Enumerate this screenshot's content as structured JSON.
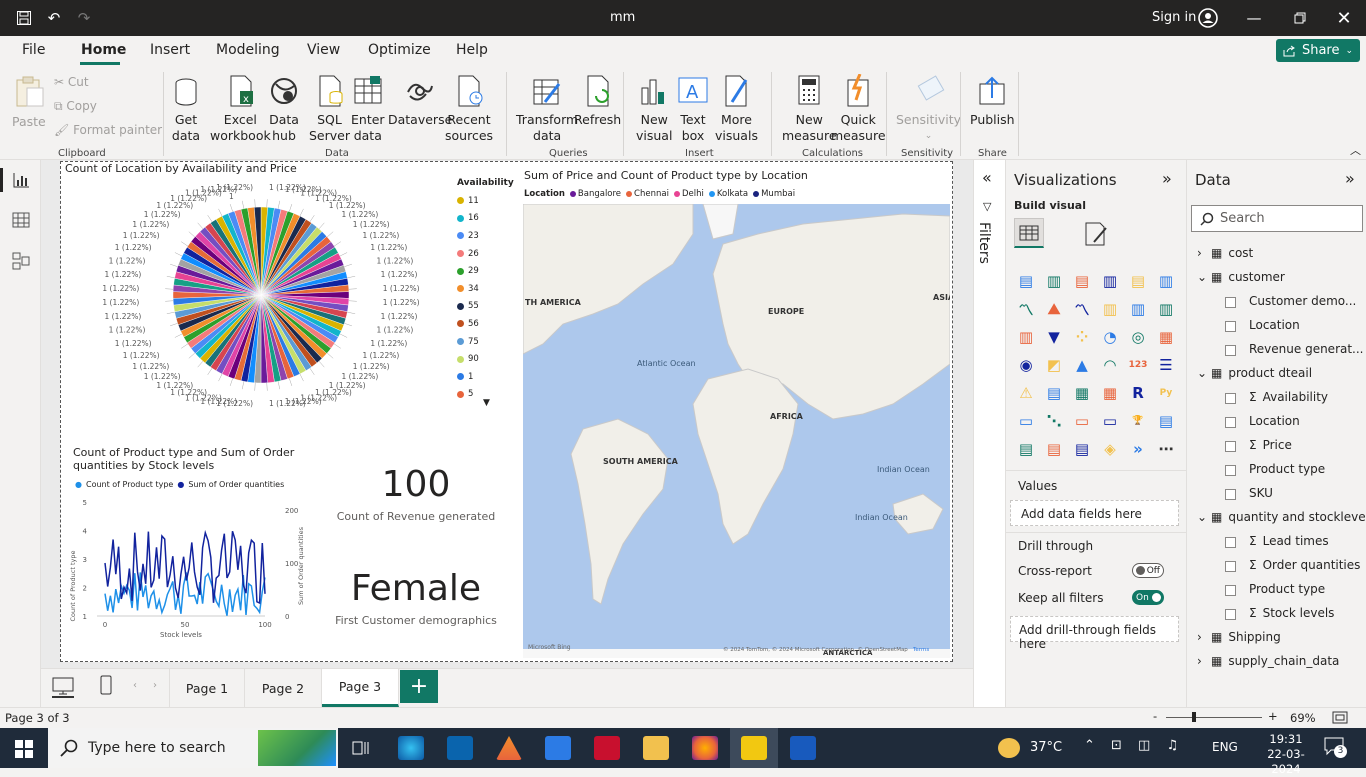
{
  "titlebar": {
    "title": "mm",
    "signin": "Sign in"
  },
  "menu": [
    "File",
    "Home",
    "Insert",
    "Modeling",
    "View",
    "Optimize",
    "Help"
  ],
  "share": "Share",
  "ribbon": {
    "clipboard": {
      "paste": "Paste",
      "cut": "Cut",
      "copy": "Copy",
      "format": "Format painter",
      "group": "Clipboard"
    },
    "data": {
      "get": [
        "Get",
        "data"
      ],
      "excel": [
        "Excel",
        "workbook"
      ],
      "hub": [
        "Data",
        "hub"
      ],
      "sql": [
        "SQL",
        "Server"
      ],
      "enter": [
        "Enter",
        "data"
      ],
      "dataverse": "Dataverse",
      "recent": [
        "Recent",
        "sources"
      ],
      "group": "Data"
    },
    "queries": {
      "transform": [
        "Transform",
        "data"
      ],
      "refresh": "Refresh",
      "group": "Queries"
    },
    "insert": {
      "new": [
        "New",
        "visual"
      ],
      "text": [
        "Text",
        "box"
      ],
      "more": [
        "More",
        "visuals"
      ],
      "group": "Insert"
    },
    "calc": {
      "measure": [
        "New",
        "measure"
      ],
      "quick": [
        "Quick",
        "measure"
      ],
      "group": "Calculations"
    },
    "sens": {
      "label": "Sensitivity",
      "group": "Sensitivity"
    },
    "share": {
      "publish": "Publish",
      "group": "Share"
    }
  },
  "pie": {
    "title": "Count of Location by Availability and Price",
    "slice_label": "1 (1.22%)",
    "top_label": "1",
    "legend_title": "Availability",
    "legend": [
      {
        "v": "11",
        "c": "#d9b300"
      },
      {
        "v": "16",
        "c": "#12b5cb"
      },
      {
        "v": "23",
        "c": "#4b8bf5"
      },
      {
        "v": "26",
        "c": "#f47b7b"
      },
      {
        "v": "29",
        "c": "#2ca02c"
      },
      {
        "v": "34",
        "c": "#f28e2b"
      },
      {
        "v": "55",
        "c": "#1b2a4e"
      },
      {
        "v": "56",
        "c": "#c0501f"
      },
      {
        "v": "75",
        "c": "#5b9bd5"
      },
      {
        "v": "90",
        "c": "#c6de6b"
      },
      {
        "v": "1",
        "c": "#2c7be5"
      },
      {
        "v": "5",
        "c": "#e8643c"
      }
    ]
  },
  "map": {
    "title": "Sum of Price and Count of Product type by Location",
    "legend_title": "Location",
    "legend": [
      {
        "n": "Bangalore",
        "c": "#6a1b9a"
      },
      {
        "n": "Chennai",
        "c": "#e8643c"
      },
      {
        "n": "Delhi",
        "c": "#e84393"
      },
      {
        "n": "Kolkata",
        "c": "#2196f3"
      },
      {
        "n": "Mumbai",
        "c": "#1a237e"
      }
    ],
    "labels": {
      "na": "TH AMERICA",
      "eu": "EUROPE",
      "asia": "ASIA",
      "atl": "Atlantic\nOcean",
      "af": "AFRICA",
      "sa": "SOUTH AMERICA",
      "io": "Indian\nOcean",
      "io2": "Indian Ocean",
      "ant": "ANTARCTICA"
    },
    "credit": "© 2024 TomTom, © 2024 Microsoft Corporation, © OpenStreetMap",
    "terms": "Terms",
    "bing": "Microsoft Bing"
  },
  "line": {
    "title": "Count of Product type and Sum of Order quantities by Stock levels",
    "s1": "Count of Product type",
    "s2": "Sum of Order quantities",
    "ylabel": "Count of Product type",
    "y2label": "Sum of Order quantities",
    "xlabel": "Stock levels",
    "yticks": [
      "1",
      "2",
      "3",
      "4",
      "5"
    ],
    "y2ticks": [
      "0",
      "100",
      "200"
    ],
    "xticks": [
      "0",
      "50",
      "100"
    ],
    "c1": "#1e90e8",
    "c2": "#12239e"
  },
  "card1": {
    "value": "100",
    "label": "Count of Revenue generated"
  },
  "card2": {
    "value": "Female",
    "label": "First Customer demographics"
  },
  "filters": "Filters",
  "viz": {
    "title": "Visualizations",
    "build": "Build visual",
    "values": "Values",
    "add_values": "Add data fields here",
    "drill": "Drill through",
    "cross": "Cross-report",
    "cross_state": "Off",
    "keep": "Keep all filters",
    "keep_state": "On",
    "add_drill": "Add drill-through fields here"
  },
  "data": {
    "title": "Data",
    "search": "Search",
    "tables": [
      {
        "name": "cost",
        "open": false,
        "fields": []
      },
      {
        "name": "customer",
        "open": true,
        "fields": [
          {
            "n": "Customer demo...",
            "s": false
          },
          {
            "n": "Location",
            "s": false
          },
          {
            "n": "Revenue generat...",
            "s": false
          }
        ]
      },
      {
        "name": "product dteail",
        "open": true,
        "fields": [
          {
            "n": "Availability",
            "s": true
          },
          {
            "n": "Location",
            "s": false
          },
          {
            "n": "Price",
            "s": true
          },
          {
            "n": "Product type",
            "s": false
          },
          {
            "n": "SKU",
            "s": false
          }
        ]
      },
      {
        "name": "quantity and stocklevel",
        "open": true,
        "fields": [
          {
            "n": "Lead times",
            "s": true
          },
          {
            "n": "Order quantities",
            "s": true
          },
          {
            "n": "Product type",
            "s": false
          },
          {
            "n": "Stock levels",
            "s": true
          }
        ]
      },
      {
        "name": "Shipping",
        "open": false,
        "fields": []
      },
      {
        "name": "supply_chain_data",
        "open": false,
        "fields": []
      }
    ]
  },
  "pages": [
    "Page 1",
    "Page 2",
    "Page 3"
  ],
  "status": {
    "page": "Page 3 of 3",
    "zoom": "69%"
  },
  "taskbar": {
    "search": "Type here to search",
    "temp": "37°C",
    "lang": "ENG",
    "time": "19:31",
    "date": "22-03-2024",
    "notif": "3"
  }
}
